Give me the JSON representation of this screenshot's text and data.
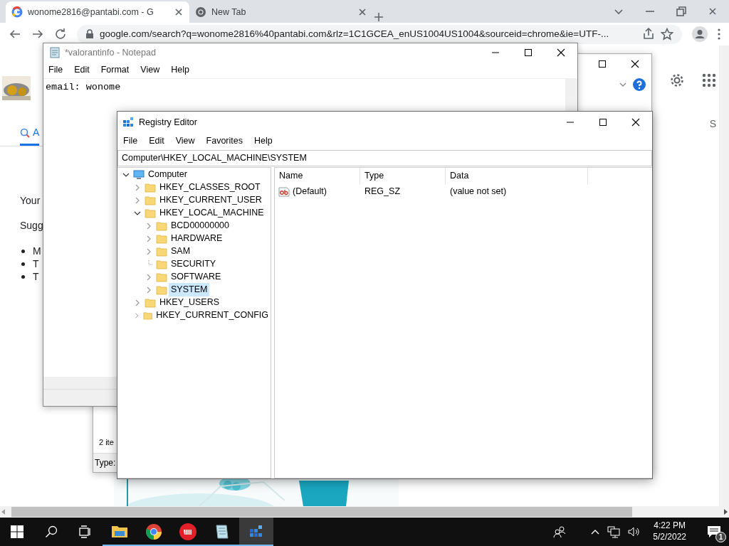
{
  "browser": {
    "tabs": [
      {
        "title": "wonome2816@pantabi.com - G",
        "selected": true
      },
      {
        "title": "New Tab",
        "selected": false
      }
    ],
    "address": "google.com/search?q=wonome2816%40pantabi.com&rlz=1C1GCEA_enUS1004US1004&sourceid=chrome&ie=UTF-...",
    "page": {
      "tab_left": "A",
      "tab_right": "S",
      "lines": [
        "Your",
        "Sugg"
      ],
      "bullets": [
        "M",
        "T",
        "T"
      ]
    }
  },
  "background_window": {
    "status": "2 ite",
    "detail": "Type:"
  },
  "notepad": {
    "title": "*valorantinfo - Notepad",
    "menu": [
      "File",
      "Edit",
      "Format",
      "View",
      "Help"
    ],
    "text": "email: wonome"
  },
  "regedit": {
    "title": "Registry Editor",
    "menu": [
      "File",
      "Edit",
      "View",
      "Favorites",
      "Help"
    ],
    "address": "Computer\\HKEY_LOCAL_MACHINE\\SYSTEM",
    "tree": [
      {
        "label": "Computer",
        "kind": "computer",
        "expandable": true,
        "expanded": true,
        "selected": false,
        "children": [
          {
            "label": "HKEY_CLASSES_ROOT",
            "kind": "folder",
            "expandable": true,
            "expanded": false,
            "selected": false
          },
          {
            "label": "HKEY_CURRENT_USER",
            "kind": "folder",
            "expandable": true,
            "expanded": false,
            "selected": false
          },
          {
            "label": "HKEY_LOCAL_MACHINE",
            "kind": "folder",
            "expandable": true,
            "expanded": true,
            "selected": false,
            "children": [
              {
                "label": "BCD00000000",
                "kind": "folder",
                "expandable": true,
                "expanded": false,
                "selected": false
              },
              {
                "label": "HARDWARE",
                "kind": "folder",
                "expandable": true,
                "expanded": false,
                "selected": false
              },
              {
                "label": "SAM",
                "kind": "folder",
                "expandable": true,
                "expanded": false,
                "selected": false
              },
              {
                "label": "SECURITY",
                "kind": "folder",
                "expandable": false,
                "expanded": false,
                "selected": false
              },
              {
                "label": "SOFTWARE",
                "kind": "folder",
                "expandable": true,
                "expanded": false,
                "selected": false
              },
              {
                "label": "SYSTEM",
                "kind": "folder",
                "expandable": true,
                "expanded": false,
                "selected": true
              }
            ]
          },
          {
            "label": "HKEY_USERS",
            "kind": "folder",
            "expandable": true,
            "expanded": false,
            "selected": false
          },
          {
            "label": "HKEY_CURRENT_CONFIG",
            "kind": "folder",
            "expandable": true,
            "expanded": false,
            "selected": false
          }
        ]
      }
    ],
    "columns": [
      "Name",
      "Type",
      "Data"
    ],
    "values": [
      {
        "name": "(Default)",
        "type": "REG_SZ",
        "data": "(value not set)"
      }
    ]
  },
  "taskbar": {
    "apps": [
      {
        "kind": "explorer",
        "running": true,
        "selected": false
      },
      {
        "kind": "chrome",
        "running": true,
        "selected": false
      },
      {
        "kind": "riot",
        "running": true,
        "selected": false
      },
      {
        "kind": "notepad",
        "running": true,
        "selected": false
      },
      {
        "kind": "regedit",
        "running": true,
        "selected": true
      }
    ],
    "time": "4:22 PM",
    "date": "5/2/2022",
    "notifications": "1"
  }
}
